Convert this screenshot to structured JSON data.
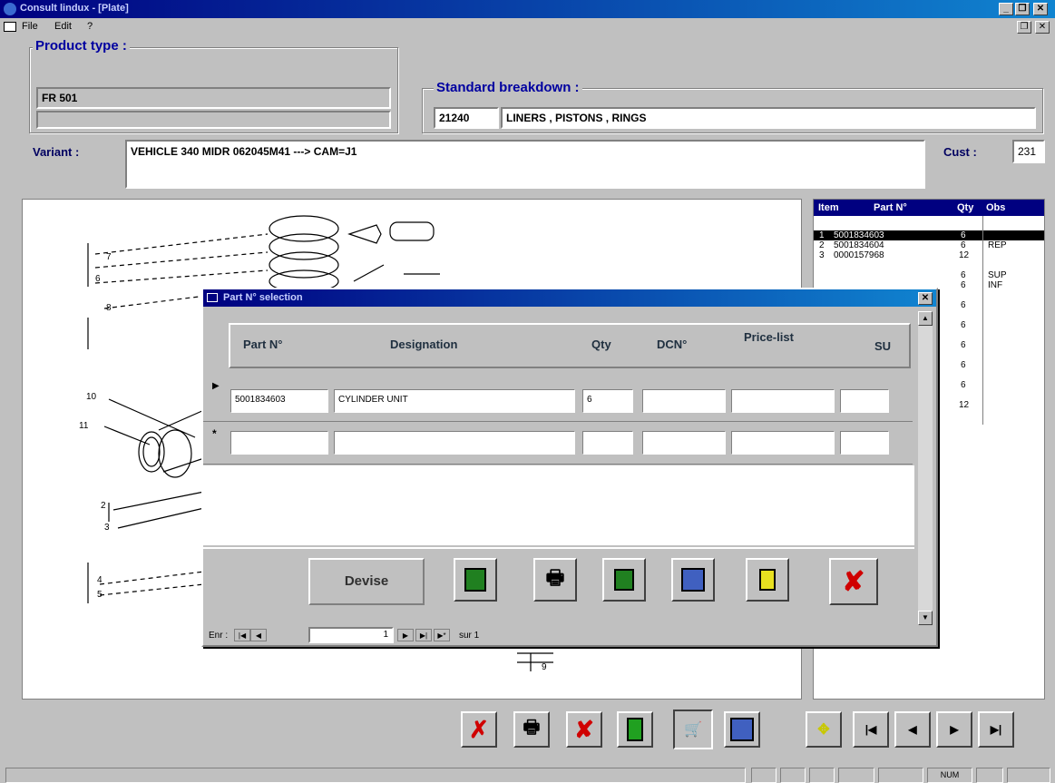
{
  "window": {
    "title": "Consult lindux - [Plate]"
  },
  "menu": {
    "file": "File",
    "edit": "Edit",
    "help": "?"
  },
  "product_type": {
    "label": "Product type :",
    "value": "FR  501",
    "value2": ""
  },
  "standard_breakdown": {
    "label": "Standard breakdown :",
    "code": "21240",
    "description": "LINERS , PISTONS , RINGS"
  },
  "variant": {
    "label": "Variant :",
    "value": "VEHICLE 340   MIDR 062045M41 ---> CAM=J1"
  },
  "cust": {
    "label": "Cust :",
    "value": "231"
  },
  "drawing_labels": [
    "7",
    "6",
    "8",
    "10",
    "11",
    "2",
    "3",
    "4",
    "5",
    "9"
  ],
  "parts_list": {
    "headers": {
      "item": "Item",
      "part": "Part N°",
      "qty": "Qty",
      "obs": "Obs"
    },
    "rows": [
      {
        "item": "1",
        "part": "5001834603",
        "qty": "6",
        "obs": ""
      },
      {
        "item": "2",
        "part": "5001834604",
        "qty": "6",
        "obs": "REP"
      },
      {
        "item": "3",
        "part": "0000157968",
        "qty": "12",
        "obs": ""
      },
      {
        "item": "",
        "part": "",
        "qty": "6",
        "obs": "SUP"
      },
      {
        "item": "",
        "part": "",
        "qty": "6",
        "obs": "INF"
      },
      {
        "item": "",
        "part": "",
        "qty": "6",
        "obs": ""
      },
      {
        "item": "",
        "part": "",
        "qty": "6",
        "obs": ""
      },
      {
        "item": "",
        "part": "",
        "qty": "6",
        "obs": ""
      },
      {
        "item": "",
        "part": "",
        "qty": "6",
        "obs": ""
      },
      {
        "item": "",
        "part": "",
        "qty": "6",
        "obs": ""
      },
      {
        "item": "",
        "part": "",
        "qty": "12",
        "obs": ""
      }
    ]
  },
  "dialog": {
    "title": "Part N° selection",
    "headers": {
      "part": "Part N°",
      "designation": "Designation",
      "qty": "Qty",
      "dcn": "DCN°",
      "price": "Price-list",
      "su": "SU"
    },
    "row1": {
      "part": "5001834603",
      "designation": "CYLINDER UNIT",
      "qty": "6",
      "dcn": "",
      "price": "",
      "su": ""
    },
    "devise": "Devise",
    "nav": {
      "prefix": "Enr :",
      "record": "1",
      "suffix": "sur 1"
    }
  },
  "statusbar": {
    "num": "NUM"
  },
  "colors": {
    "selection": "#000080",
    "dialog_blue": "#0000a0",
    "delete_red": "#d00000"
  }
}
